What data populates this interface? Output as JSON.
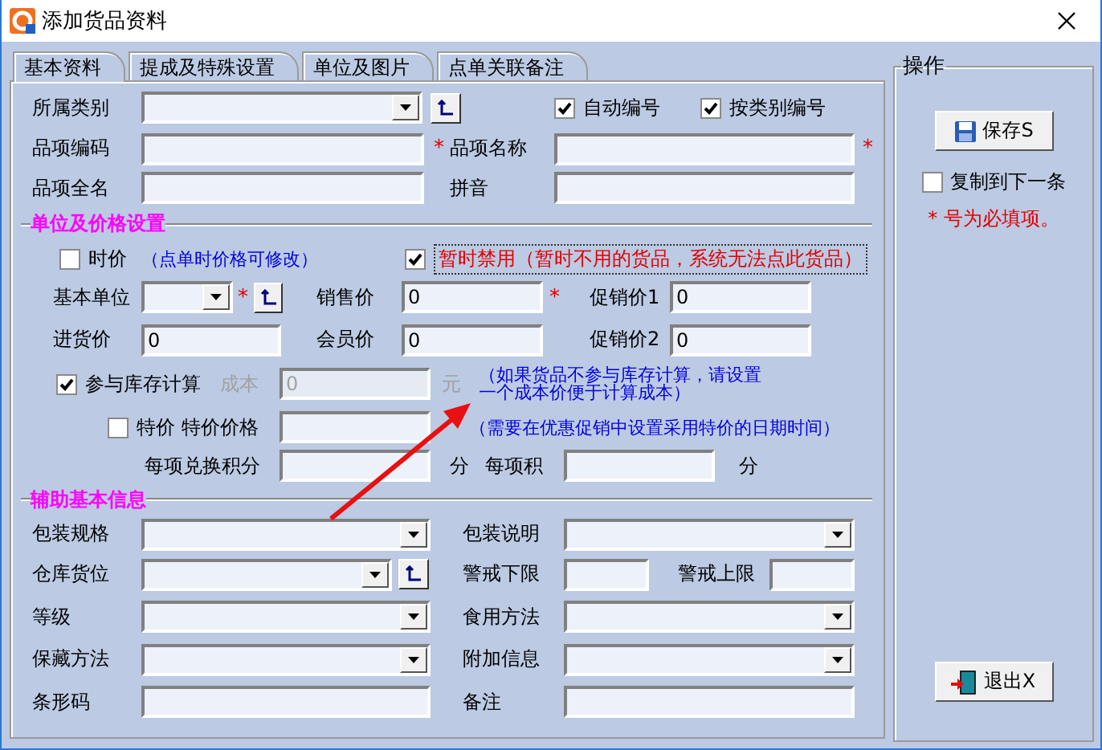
{
  "window": {
    "title": "添加货品资料"
  },
  "tabs": [
    {
      "label": "基本资料",
      "selected": true
    },
    {
      "label": "提成及特殊设置",
      "selected": false
    },
    {
      "label": "单位及图片",
      "selected": false
    },
    {
      "label": "点单关联备注",
      "selected": false
    }
  ],
  "rows": [
    {
      "items": [
        {
          "kind": "label",
          "text": "所属类别"
        },
        {
          "kind": "combo"
        },
        {
          "kind": "lookup"
        },
        {
          "kind": "checkbox",
          "label": "自动编号",
          "checked": true
        },
        {
          "kind": "checkbox",
          "label": "按类别编号",
          "checked": true
        }
      ]
    },
    {
      "items": [
        {
          "kind": "label",
          "text": "品项编码"
        },
        {
          "kind": "input"
        },
        {
          "kind": "required",
          "text": "*"
        },
        {
          "kind": "label",
          "text": "品项名称"
        },
        {
          "kind": "input"
        },
        {
          "kind": "required",
          "text": "*"
        }
      ]
    },
    {
      "items": [
        {
          "kind": "label",
          "text": "品项全名"
        },
        {
          "kind": "input"
        },
        {
          "kind": "label",
          "text": "拼音"
        },
        {
          "kind": "input"
        }
      ]
    },
    {
      "heading": "单位及价格设置"
    },
    {
      "items": [
        {
          "kind": "checkbox",
          "label": "时价",
          "checked": false
        },
        {
          "kind": "note",
          "lines": [
            "（点单时价格可修改）"
          ]
        },
        {
          "kind": "warning-checkbox",
          "label": "暂时禁用（暂时不用的货品，系统无法点此货品）",
          "checked": true
        }
      ]
    },
    {
      "items": [
        {
          "kind": "label",
          "text": "基本单位"
        },
        {
          "kind": "combo"
        },
        {
          "kind": "required",
          "text": "*"
        },
        {
          "kind": "lookup"
        },
        {
          "kind": "label",
          "text": "销售价"
        },
        {
          "kind": "input",
          "value": "0"
        },
        {
          "kind": "required",
          "text": "*"
        },
        {
          "kind": "label",
          "text": "促销价1"
        },
        {
          "kind": "input",
          "value": "0"
        }
      ]
    },
    {
      "items": [
        {
          "kind": "label",
          "text": "进货价"
        },
        {
          "kind": "input",
          "value": "0"
        },
        {
          "kind": "label",
          "text": "会员价"
        },
        {
          "kind": "input",
          "value": "0"
        },
        {
          "kind": "label",
          "text": "促销价2"
        },
        {
          "kind": "input",
          "value": "0"
        }
      ]
    },
    {
      "items": [
        {
          "kind": "checkbox",
          "label": "参与库存计算",
          "checked": true
        },
        {
          "kind": "label",
          "text": "成本",
          "disabled": true
        },
        {
          "kind": "input",
          "value": "0",
          "disabled": true
        },
        {
          "kind": "label",
          "text": "元",
          "disabled": true
        },
        {
          "kind": "note",
          "lines": [
            "（如果货品不参与库存计算，请设置",
            "一个成本价便于计算成本）"
          ]
        }
      ]
    },
    {
      "items": [
        {
          "kind": "checkbox",
          "label": "特价",
          "checked": false
        },
        {
          "kind": "label",
          "text": "特价价格"
        },
        {
          "kind": "input"
        },
        {
          "kind": "note",
          "lines": [
            "（需要在优惠促销中设置采用特价的日期时间）"
          ]
        }
      ]
    },
    {
      "items": [
        {
          "kind": "label",
          "text": "每项兑换积分"
        },
        {
          "kind": "input"
        },
        {
          "kind": "label",
          "text": "分"
        },
        {
          "kind": "label",
          "text": "每项积"
        },
        {
          "kind": "input"
        },
        {
          "kind": "label",
          "text": "分"
        }
      ]
    },
    {
      "heading": "辅助基本信息"
    },
    {
      "items": [
        {
          "kind": "label",
          "text": "包装规格"
        },
        {
          "kind": "combo"
        },
        {
          "kind": "label",
          "text": "包装说明"
        },
        {
          "kind": "combo"
        }
      ]
    },
    {
      "items": [
        {
          "kind": "label",
          "text": "仓库货位"
        },
        {
          "kind": "combo"
        },
        {
          "kind": "lookup"
        },
        {
          "kind": "label",
          "text": "警戒下限"
        },
        {
          "kind": "input"
        },
        {
          "kind": "label",
          "text": "警戒上限"
        },
        {
          "kind": "input"
        }
      ]
    },
    {
      "items": [
        {
          "kind": "label",
          "text": "等级"
        },
        {
          "kind": "combo"
        },
        {
          "kind": "label",
          "text": "食用方法"
        },
        {
          "kind": "combo"
        }
      ]
    },
    {
      "items": [
        {
          "kind": "label",
          "text": "保藏方法"
        },
        {
          "kind": "combo"
        },
        {
          "kind": "label",
          "text": "附加信息"
        },
        {
          "kind": "combo"
        }
      ]
    },
    {
      "items": [
        {
          "kind": "label",
          "text": "条形码"
        },
        {
          "kind": "input"
        },
        {
          "kind": "label",
          "text": "备注"
        },
        {
          "kind": "input"
        }
      ]
    }
  ],
  "side": {
    "title": "操作",
    "save": "保存S",
    "copy_next": {
      "label": "复制到下一条",
      "checked": false
    },
    "required_note": "* 号为必填项。",
    "exit": "退出X"
  }
}
